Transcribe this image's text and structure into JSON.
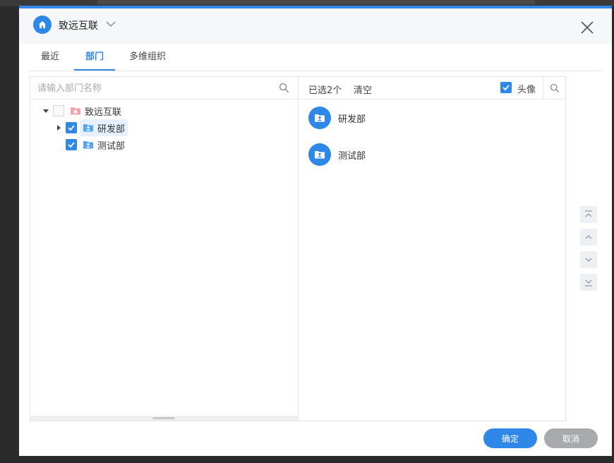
{
  "header": {
    "title": "致远互联"
  },
  "tabs": [
    {
      "label": "最近",
      "active": false
    },
    {
      "label": "部门",
      "active": true
    },
    {
      "label": "多维组织",
      "active": false
    }
  ],
  "left": {
    "search_placeholder": "请输入部门名称",
    "tree": [
      {
        "label": "致远互联",
        "checked": false,
        "expanded": true,
        "level": 0
      },
      {
        "label": "研发部",
        "checked": true,
        "expanded": false,
        "level": 1
      },
      {
        "label": "测试部",
        "checked": true,
        "level": 1
      }
    ]
  },
  "right": {
    "selected_count": "已选2个",
    "clear_label": "清空",
    "avatar_label": "头像",
    "avatar_checked": true,
    "items": [
      {
        "label": "研发部"
      },
      {
        "label": "测试部"
      }
    ]
  },
  "footer": {
    "ok_label": "确定",
    "cancel_label": "取消"
  },
  "colors": {
    "accent": "#2f88e8",
    "cancel": "#a8aaad",
    "root_folder": "#f3a2ae",
    "dept_folder": "#5aa5f0"
  }
}
